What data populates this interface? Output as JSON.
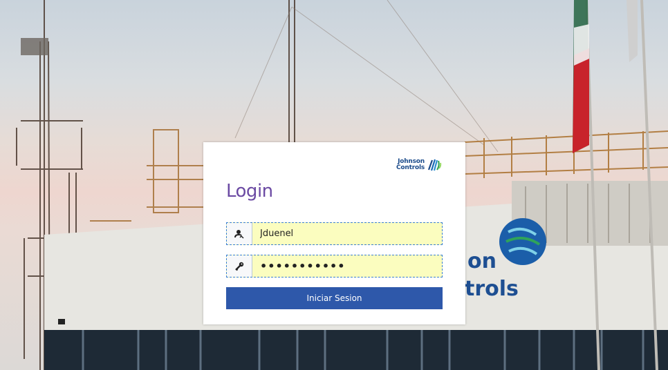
{
  "login": {
    "title": "Login",
    "brand": {
      "line1": "Johnson",
      "line2": "Controls"
    },
    "username": {
      "value": "Jduenel",
      "icon": "user-icon"
    },
    "password": {
      "value": "•••••••••••",
      "icon": "key-icon"
    },
    "submit_label": "Iniciar Sesion"
  },
  "background": {
    "sign_text_1": "on",
    "sign_text_2": "trols"
  },
  "colors": {
    "title": "#6b4aa3",
    "button": "#2e58aa",
    "field_bg": "#fbfdbf",
    "field_border": "#3a7fd0",
    "brand": "#1a4a8a"
  }
}
